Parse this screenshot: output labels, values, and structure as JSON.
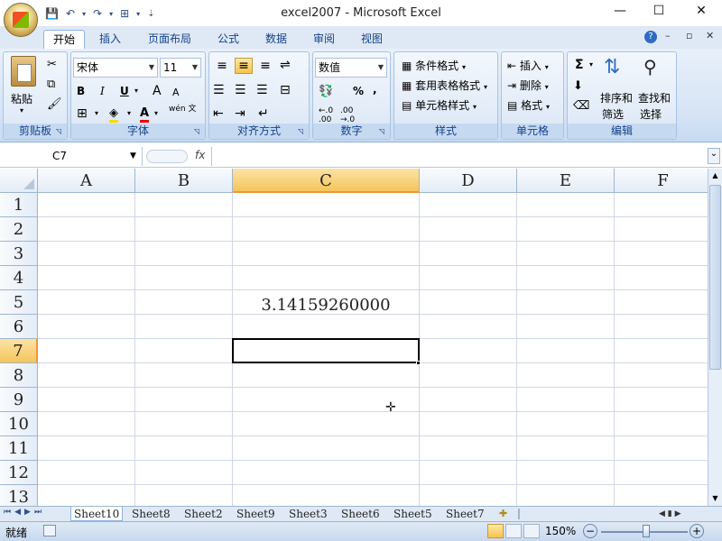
{
  "window": {
    "title": "excel2007 - Microsoft Excel",
    "min": "—",
    "max": "☐",
    "close": "✕"
  },
  "qat": {
    "save": "💾",
    "undo": "↶",
    "redo": "↷",
    "custom": "⊞"
  },
  "tabs": [
    "开始",
    "插入",
    "页面布局",
    "公式",
    "数据",
    "审阅",
    "视图"
  ],
  "help_icons": {
    "help": "?",
    "min": "–",
    "restore": "▫",
    "close": "✕"
  },
  "ribbon": {
    "clipboard": {
      "label": "剪贴板",
      "paste": "粘贴"
    },
    "font": {
      "label": "字体",
      "name": "宋体",
      "size": "11",
      "bold": "B",
      "italic": "I",
      "underline": "U",
      "grow": "A",
      "shrink": "A",
      "phonetic": "wén 文"
    },
    "alignment": {
      "label": "对齐方式"
    },
    "number": {
      "label": "数字",
      "format": "数值",
      "percent": "%",
      "comma": ","
    },
    "styles": {
      "label": "样式",
      "conditional": "条件格式",
      "table": "套用表格格式",
      "cell": "单元格样式"
    },
    "cells": {
      "label": "单元格",
      "insert": "插入",
      "delete": "删除",
      "format": "格式"
    },
    "editing": {
      "label": "编辑",
      "sigma": "Σ",
      "sort": "排序和",
      "sort2": "筛选",
      "find": "查找和",
      "find2": "选择"
    }
  },
  "formula_bar": {
    "name_box": "C7",
    "fx": "fx",
    "content": ""
  },
  "columns": [
    "A",
    "B",
    "C",
    "D",
    "E",
    "F"
  ],
  "rows": [
    "1",
    "2",
    "3",
    "4",
    "5",
    "6",
    "7",
    "8",
    "9",
    "10",
    "11",
    "12",
    "13"
  ],
  "cells": {
    "C5": "3.14159260000"
  },
  "selected_cell": "C7",
  "sheets": [
    "Sheet10",
    "Sheet8",
    "Sheet2",
    "Sheet9",
    "Sheet3",
    "Sheet6",
    "Sheet5",
    "Sheet7"
  ],
  "active_sheet": "Sheet10",
  "status": {
    "ready": "就绪",
    "zoom": "150%"
  }
}
